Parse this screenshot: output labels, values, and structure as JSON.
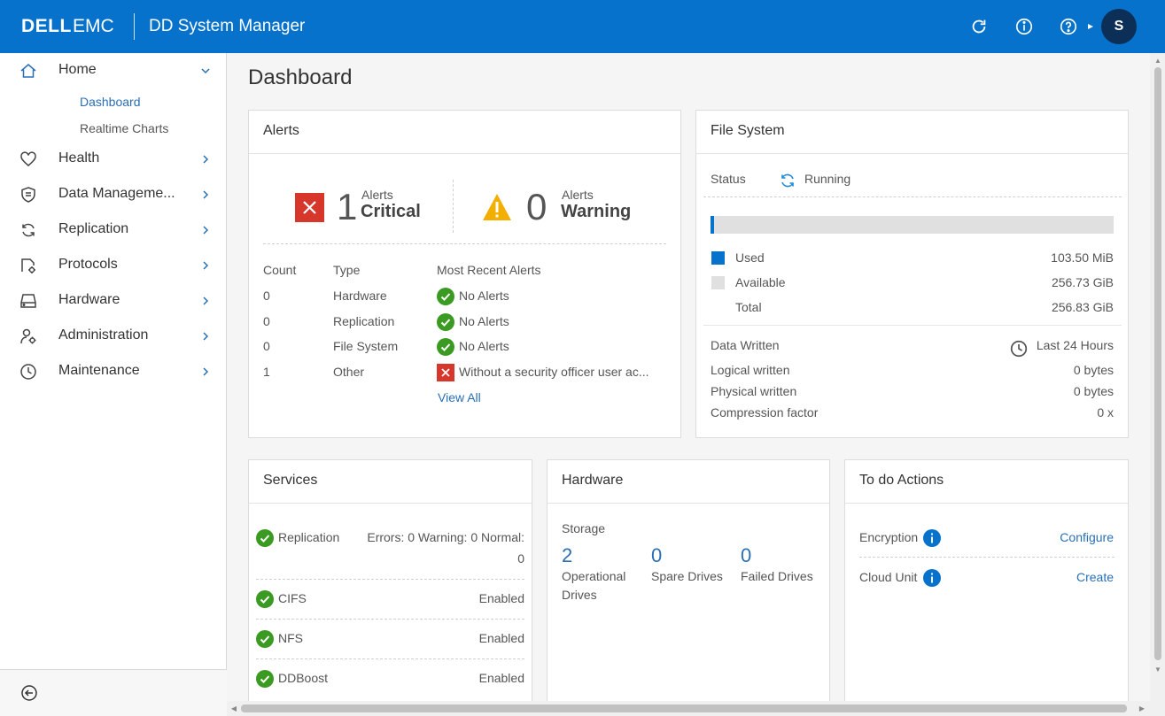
{
  "header": {
    "brand_dell": "DELL",
    "brand_emc": "EMC",
    "app_title": "DD System Manager",
    "user_initial": "S",
    "accent_color": "#0672cb"
  },
  "sidebar": {
    "items": [
      {
        "label": "Home",
        "icon": "home-icon"
      },
      {
        "label": "Health",
        "icon": "heart-icon"
      },
      {
        "label": "Data Manageme...",
        "icon": "shield-icon"
      },
      {
        "label": "Replication",
        "icon": "replication-icon"
      },
      {
        "label": "Protocols",
        "icon": "protocols-icon"
      },
      {
        "label": "Hardware",
        "icon": "hardware-icon"
      },
      {
        "label": "Administration",
        "icon": "administration-icon"
      },
      {
        "label": "Maintenance",
        "icon": "maintenance-icon"
      }
    ],
    "home_sub": [
      "Dashboard",
      "Realtime Charts"
    ],
    "active_sub": "Dashboard"
  },
  "page": {
    "title": "Dashboard"
  },
  "alerts": {
    "title": "Alerts",
    "critical": {
      "count": "1",
      "label_small": "Alerts",
      "label_big": "Critical"
    },
    "warning": {
      "count": "0",
      "label_small": "Alerts",
      "label_big": "Warning"
    },
    "columns": [
      "Count",
      "Type",
      "Most Recent Alerts"
    ],
    "rows": [
      {
        "count": "0",
        "type": "Hardware",
        "recent": "No Alerts",
        "status": "ok"
      },
      {
        "count": "0",
        "type": "Replication",
        "recent": "No Alerts",
        "status": "ok"
      },
      {
        "count": "0",
        "type": "File System",
        "recent": "No Alerts",
        "status": "ok"
      },
      {
        "count": "1",
        "type": "Other",
        "recent": "Without a security officer user ac...",
        "status": "critical"
      }
    ],
    "view_all": "View All"
  },
  "filesystem": {
    "title": "File System",
    "status_label": "Status",
    "status_value": "Running",
    "used_fraction": 0.0004,
    "used_label": "Used",
    "used_value": "103.50 MiB",
    "available_label": "Available",
    "available_value": "256.73 GiB",
    "total_label": "Total",
    "total_value": "256.83 GiB",
    "data_written_label": "Data Written",
    "period": "Last 24 Hours",
    "logical_label": "Logical written",
    "logical_value": "0 bytes",
    "physical_label": "Physical written",
    "physical_value": "0 bytes",
    "compression_label": "Compression factor",
    "compression_value": "0 x",
    "used_color": "#0672cb",
    "available_color": "#e0e0e0"
  },
  "services": {
    "title": "Services",
    "replication": {
      "name": "Replication",
      "status_line1": "Errors: 0 Warning: 0 Normal:",
      "status_line2": "0"
    },
    "items": [
      {
        "name": "CIFS",
        "status": "Enabled"
      },
      {
        "name": "NFS",
        "status": "Enabled"
      },
      {
        "name": "DDBoost",
        "status": "Enabled"
      }
    ]
  },
  "hardware": {
    "title": "Hardware",
    "storage_label": "Storage",
    "operational": {
      "value": "2",
      "label1": "Operational",
      "label2": "Drives"
    },
    "spare": {
      "value": "0",
      "label": "Spare Drives"
    },
    "failed": {
      "value": "0",
      "label": "Failed Drives"
    }
  },
  "todo": {
    "title": "To do Actions",
    "items": [
      {
        "label": "Encryption",
        "action": "Configure"
      },
      {
        "label": "Cloud Unit",
        "action": "Create"
      }
    ]
  }
}
